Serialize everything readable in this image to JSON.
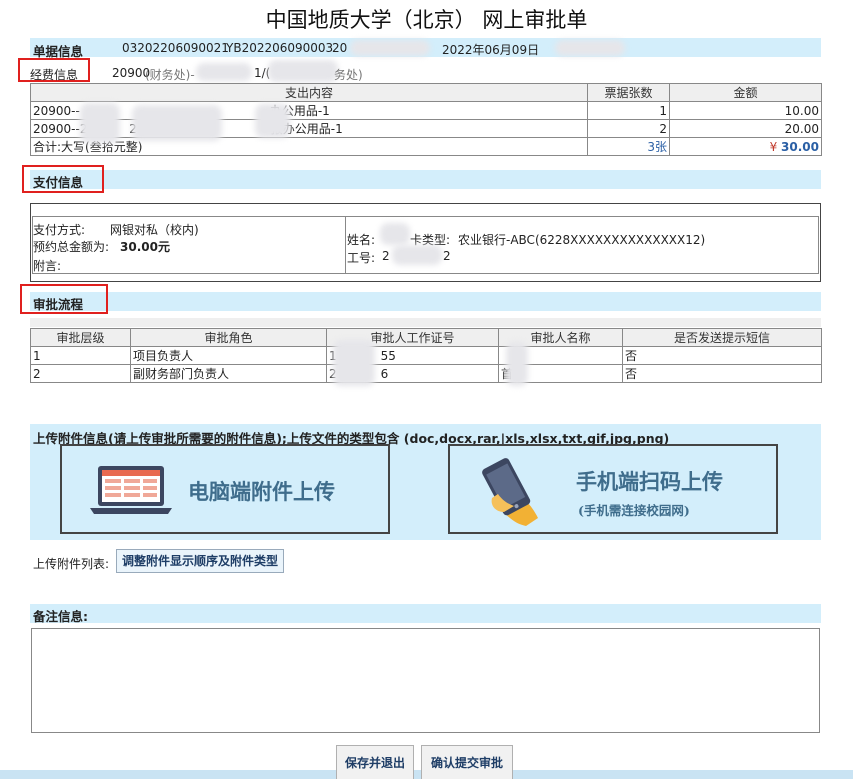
{
  "page_title": "中国地质大学（北京） 网上审批单",
  "doc_info": {
    "header": "单据信息",
    "number": "03202206090021",
    "yb_code": "YB202206090003",
    "code_prefix": "20",
    "date": "2022年06月09日"
  },
  "expense_info": {
    "label": "经费信息",
    "code": "20900",
    "dept": "(财务处)-",
    "partial": "1/(",
    "dept2_suffix": "务处)"
  },
  "expense_table": {
    "columns": [
      "支出内容",
      "票据张数",
      "金额"
    ],
    "rows": [
      {
        "prefix": "20900--",
        "mid": "",
        "suffix": "办公用品-1",
        "count": "1",
        "amount": "10.00"
      },
      {
        "prefix": "20900--20",
        "mid": "2",
        "suffix": "报办公用品-1",
        "count": "2",
        "amount": "20.00"
      }
    ],
    "total": {
      "label": "合计:大写(叁拾元整)",
      "count": "3张",
      "currency": "¥",
      "amount": "30.00"
    }
  },
  "payment": {
    "header": "支付信息",
    "method_label": "支付方式:",
    "method": "网银对私（校内)",
    "prepay_label": "预约总金额为:",
    "prepay_amount": "30.00元",
    "note_label": "附言:",
    "name_label": "姓名:",
    "card_type_label": "卡类型:",
    "card_type": "农业银行-ABC(6228XXXXXXXXXXXXXX12)",
    "staff_label": "工号:",
    "staff_prefix": "2",
    "staff_suffix": "2"
  },
  "approval": {
    "header": "审批流程",
    "columns": [
      "审批层级",
      "审批角色",
      "审批人工作证号",
      "审批人名称",
      "是否发送提示短信"
    ],
    "rows": [
      {
        "level": "1",
        "role": "项目负责人",
        "id_prefix": "1",
        "id_suffix": "55",
        "name": "",
        "sms": "否"
      },
      {
        "level": "2",
        "role": "副财务部门负责人",
        "id_prefix": "2",
        "id_suffix": "6",
        "name": "首",
        "sms": "否"
      }
    ]
  },
  "upload": {
    "title": "上传附件信息(请上传审批所需要的附件信息);上传文件的类型包含 (doc,docx,rar,|xls,xlsx,txt,gif,jpg,png)",
    "pc_label": "电脑端附件上传",
    "mobile_label": "手机端扫码上传",
    "mobile_sub": "(手机需连接校园网)",
    "list_label": "上传附件列表:",
    "adjust_button": "调整附件显示顺序及附件类型"
  },
  "remark": {
    "label": "备注信息:",
    "value": ""
  },
  "actions": {
    "save_exit": "保存并退出",
    "submit": "确认提交审批"
  },
  "colors": {
    "band": "#d3eefb",
    "highlight_box": "#e0201e",
    "amount_blue": "#2a5fa5"
  }
}
